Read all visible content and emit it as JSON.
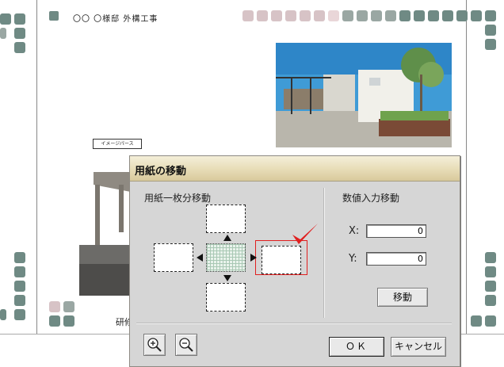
{
  "sheet": {
    "title": "〇〇 〇様邸 外構工事",
    "image_label": "イメージパース",
    "footer_text": "研修"
  },
  "dialog": {
    "title": "用紙の移動",
    "left_group": {
      "label": "用紙一枚分移動"
    },
    "right_group": {
      "label": "数値入力移動",
      "x_label": "X:",
      "x_value": "0",
      "y_label": "Y:",
      "y_value": "0",
      "move_button": "移動"
    },
    "ok_button": "ＯＫ",
    "cancel_button": "キャンセル",
    "icons": {
      "zoom_in": "zoom-in-icon",
      "zoom_out": "zoom-out-icon",
      "check": "check-mark-icon"
    },
    "colors": {
      "titlebar": "#e7dcb6",
      "dialog_bg": "#d6d6d6",
      "highlight": "#e02020",
      "border_squares": "#6f8a84"
    }
  }
}
